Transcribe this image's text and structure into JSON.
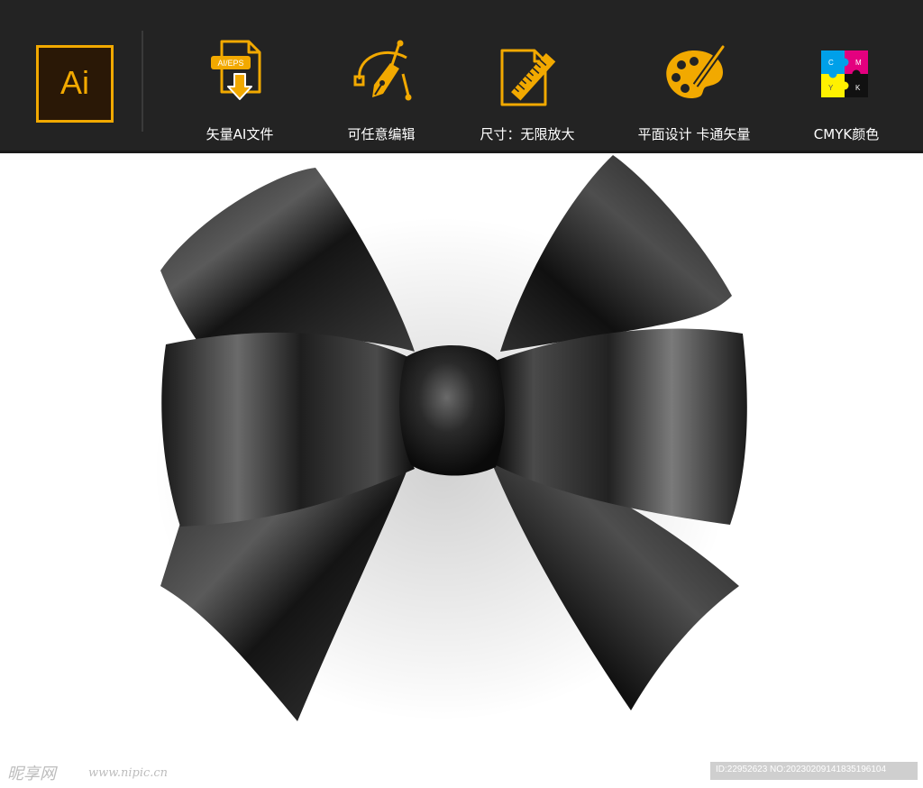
{
  "banner": {
    "logo_text": "Ai",
    "features": [
      {
        "label": "矢量AI文件",
        "icon": "ai-eps-file-download-icon",
        "file_badge": "AI/EPS"
      },
      {
        "label": "可任意编辑",
        "icon": "pen-tool-icon"
      },
      {
        "label": "尺寸：无限放大",
        "icon": "ruler-document-icon"
      },
      {
        "label": "平面设计  卡通矢量",
        "icon": "paint-palette-icon"
      },
      {
        "label": "CMYK颜色",
        "icon": "cmyk-puzzle-icon",
        "puzzle_letters": [
          "C",
          "M",
          "Y",
          "K"
        ]
      }
    ]
  },
  "artwork": {
    "subject": "black-satin-ribbon-bow"
  },
  "watermark": {
    "logo": "昵享网",
    "url": "www.nipic.cn",
    "id_text": "ID:22952623 NO:20230209141835196104"
  },
  "colors": {
    "banner_bg": "#232323",
    "accent": "#f2a900",
    "text": "#ffffff",
    "ribbon": "#1b1b1b",
    "cmyk": [
      "#00a0e9",
      "#e4007f",
      "#fff100",
      "#111111"
    ]
  }
}
